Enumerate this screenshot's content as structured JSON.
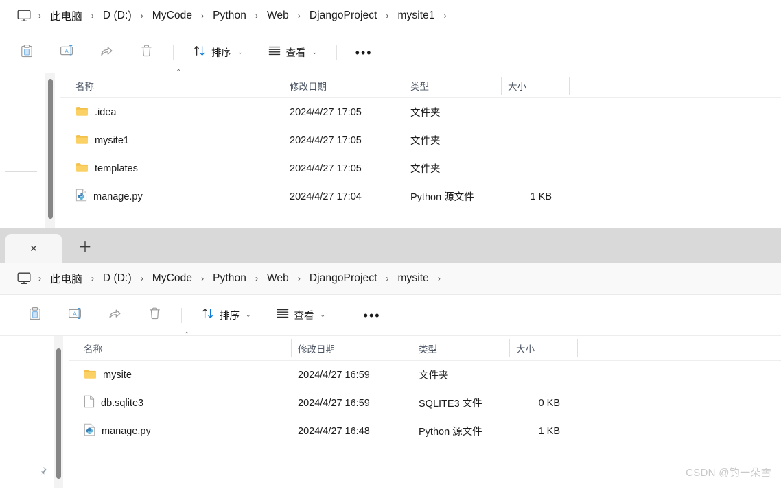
{
  "watermark": "CSDN @钓一朵雪",
  "windows": [
    {
      "id": "top",
      "breadcrumb": {
        "home_icon": "monitor-icon",
        "separator": "›",
        "items": [
          "此电脑",
          "D (D:)",
          "MyCode",
          "Python",
          "Web",
          "DjangoProject",
          "mysite1"
        ]
      },
      "toolbar": {
        "paste_label": "粘贴",
        "rename_label": "重命名",
        "share_label": "共享",
        "delete_label": "删除",
        "sort_label": "排序",
        "view_label": "查看",
        "more_label": "…",
        "caret": "⌄",
        "dots": "•••"
      },
      "columns": [
        {
          "label": "名称",
          "sorted": "ascending",
          "sort_caret": "⌃"
        },
        {
          "label": "修改日期"
        },
        {
          "label": "类型"
        },
        {
          "label": "大小"
        }
      ],
      "rows": [
        {
          "icon": "folder-icon",
          "name": ".idea",
          "modified": "2024/4/27 17:05",
          "type": "文件夹",
          "size": ""
        },
        {
          "icon": "folder-icon",
          "name": "mysite1",
          "modified": "2024/4/27 17:05",
          "type": "文件夹",
          "size": ""
        },
        {
          "icon": "folder-icon",
          "name": "templates",
          "modified": "2024/4/27 17:05",
          "type": "文件夹",
          "size": ""
        },
        {
          "icon": "python-file-icon",
          "name": "manage.py",
          "modified": "2024/4/27 17:04",
          "type": "Python 源文件",
          "size": "1 KB"
        }
      ]
    },
    {
      "id": "bottom",
      "tabs": {
        "close_label": "✕",
        "new_tab_label": "＋"
      },
      "breadcrumb": {
        "home_icon": "monitor-icon",
        "separator": "›",
        "items": [
          "此电脑",
          "D (D:)",
          "MyCode",
          "Python",
          "Web",
          "DjangoProject",
          "mysite"
        ]
      },
      "toolbar": {
        "paste_label": "粘贴",
        "rename_label": "重命名",
        "share_label": "共享",
        "delete_label": "删除",
        "sort_label": "排序",
        "view_label": "查看",
        "more_label": "…",
        "caret": "⌄",
        "dots": "•••"
      },
      "columns": [
        {
          "label": "名称",
          "sorted": "ascending",
          "sort_caret": "⌃"
        },
        {
          "label": "修改日期"
        },
        {
          "label": "类型"
        },
        {
          "label": "大小"
        }
      ],
      "rows": [
        {
          "icon": "folder-icon",
          "name": "mysite",
          "modified": "2024/4/27 16:59",
          "type": "文件夹",
          "size": ""
        },
        {
          "icon": "blank-file-icon",
          "name": "db.sqlite3",
          "modified": "2024/4/27 16:59",
          "type": "SQLITE3 文件",
          "size": "0 KB"
        },
        {
          "icon": "python-file-icon",
          "name": "manage.py",
          "modified": "2024/4/27 16:48",
          "type": "Python 源文件",
          "size": "1 KB"
        }
      ]
    }
  ],
  "colors": {
    "folder": "#f5c451",
    "accent": "#0078d4",
    "tabstrip": "#d9d9d9",
    "header_text": "#4d5766"
  }
}
